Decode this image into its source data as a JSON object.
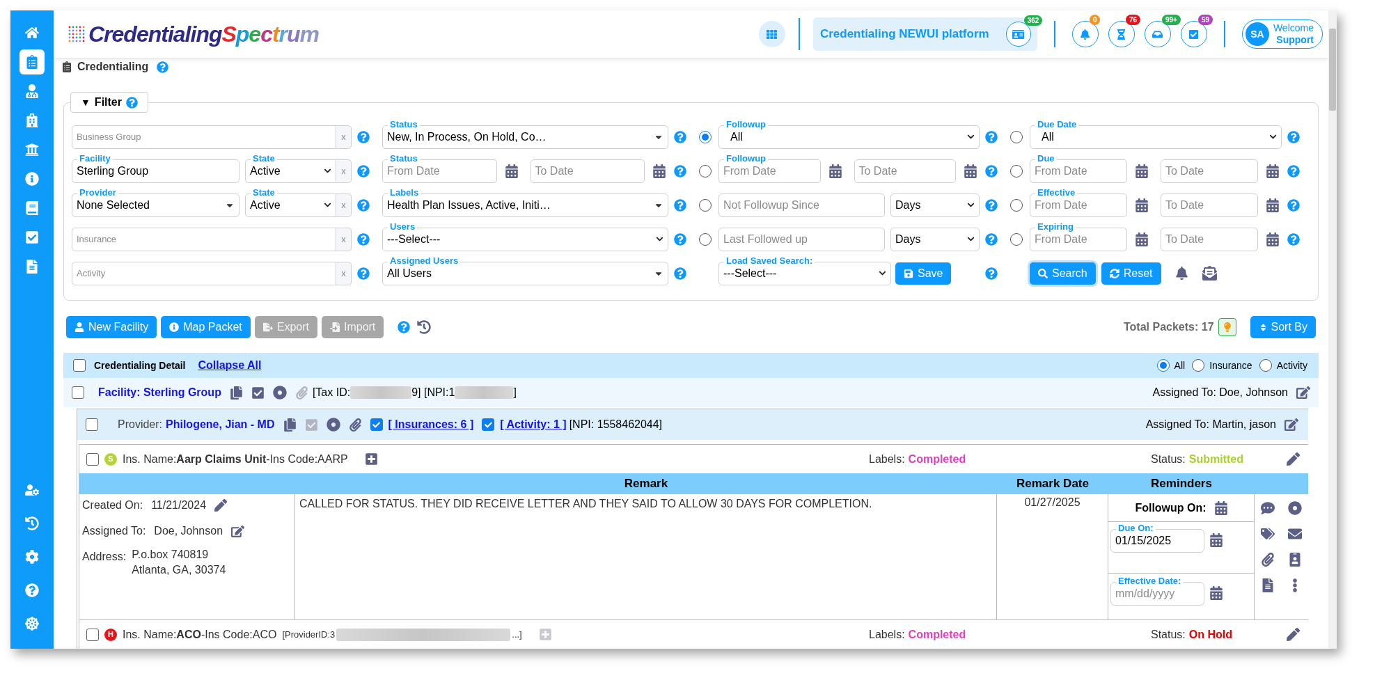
{
  "sidebar": {
    "items": [
      {
        "selected": false
      },
      {
        "selected": true
      },
      {
        "selected": false
      },
      {
        "selected": false
      },
      {
        "selected": false
      },
      {
        "selected": false
      },
      {
        "selected": false
      },
      {
        "selected": false
      },
      {
        "selected": false
      }
    ]
  },
  "header": {
    "logo": {
      "part_1": "Credentialing",
      "part_2": "Spectrum"
    },
    "platform": {
      "title": "Credentialing NEWUI platform",
      "badge": "362"
    },
    "notifications": [
      {
        "badge": "0",
        "color": "#f7931e"
      },
      {
        "badge": "76",
        "color": "#e8141b"
      },
      {
        "badge": "99+",
        "color": "#22b14c"
      },
      {
        "badge": "59",
        "color": "#b43fc0"
      }
    ],
    "user": {
      "initials": "SA",
      "greeting": "Welcome",
      "name": "Support"
    }
  },
  "breadcrumb": {
    "title": "Credentialing"
  },
  "filter": {
    "toggle": "▼",
    "title": "Filter",
    "columns": [
      {
        "rows": [
          {
            "kind": "text",
            "placeholder": "Business Group",
            "clear": "x"
          },
          {
            "kind": "text_state",
            "label": "Facility",
            "value": "Sterling Group",
            "state_label": "State",
            "state": "Active",
            "clear": "x"
          },
          {
            "kind": "select_state",
            "label": "Provider",
            "value": "None Selected",
            "state_label": "State",
            "state": "Active",
            "clear": "x"
          },
          {
            "kind": "text",
            "placeholder": "Insurance",
            "clear": "x"
          },
          {
            "kind": "text",
            "placeholder": "Activity",
            "clear": "x"
          }
        ]
      },
      {
        "rows": [
          {
            "kind": "multiselect",
            "label": "Status",
            "value": "New, In Process, On Hold, Co…"
          },
          {
            "kind": "date_range",
            "label": "Status",
            "from_placeholder": "From Date",
            "to_placeholder": "To Date"
          },
          {
            "kind": "multiselect",
            "label": "Labels",
            "value": "Health Plan Issues, Active, Initi…"
          },
          {
            "kind": "select",
            "label": "Users",
            "value": "---Select---"
          },
          {
            "kind": "multiselect",
            "label": "Assigned Users",
            "value": "All Users"
          }
        ]
      },
      {
        "rows": [
          {
            "kind": "select",
            "label": "Followup",
            "value": "All",
            "selected": true
          },
          {
            "kind": "date_range",
            "label": "Followup",
            "from_placeholder": "From Date",
            "to_placeholder": "To Date",
            "selected": false
          },
          {
            "kind": "text_unit",
            "placeholder": "Not Followup Since",
            "unit": "Days",
            "selected": false
          },
          {
            "kind": "text_unit",
            "placeholder": "Last Followed up",
            "unit": "Days",
            "selected": false
          }
        ]
      },
      {
        "rows": [
          {
            "kind": "select",
            "label": "Due Date",
            "value": "All",
            "selected": false
          },
          {
            "kind": "date_range",
            "label": "Due",
            "from_placeholder": "From Date",
            "to_placeholder": "To Date",
            "selected": false
          },
          {
            "kind": "date_range",
            "label": "Effective",
            "from_placeholder": "From Date",
            "to_placeholder": "To Date",
            "selected": false
          },
          {
            "kind": "date_range",
            "label": "Expiring",
            "from_placeholder": "From Date",
            "to_placeholder": "To Date",
            "selected": false
          }
        ]
      }
    ],
    "saved_search": {
      "label": "Load Saved Search:",
      "value": "---Select---",
      "button": "Save"
    },
    "actions": {
      "search": "Search",
      "reset": "Reset"
    }
  },
  "toolbar": {
    "buttons": [
      {
        "label": "New Facility",
        "disabled": false
      },
      {
        "label": "Map Packet",
        "disabled": false
      },
      {
        "label": "Export",
        "disabled": true
      },
      {
        "label": "Import",
        "disabled": true
      }
    ],
    "total_packets": "Total Packets: 17",
    "sort": "Sort By"
  },
  "detail": {
    "header": {
      "checked": false,
      "title": "Credentialing Detail",
      "collapse": "Collapse All",
      "views": [
        {
          "label": "All",
          "selected": true
        },
        {
          "label": "Insurance",
          "selected": false
        },
        {
          "label": "Activity",
          "selected": false
        }
      ]
    },
    "facility": {
      "checked": false,
      "title": "Facility: Sterling Group",
      "tax_prefix": "[Tax ID:",
      "npi_prefix": "9] [NPI:1",
      "npi_suffix": "]",
      "assigned": "Assigned To: Doe, Johnson"
    },
    "provider": {
      "checked": false,
      "label": "Provider:",
      "name": "Philogene, Jian - MD",
      "insurances": {
        "checked": true,
        "label": "[ Insurances: 6 ]"
      },
      "activity": {
        "checked": true,
        "label": "[ Activity: 1 ]"
      },
      "npi": "[NPI: 1558462044]",
      "assigned": "Assigned To: Martin, jason"
    },
    "insurances": [
      {
        "checked": false,
        "badge": "S",
        "color": "#b5d334",
        "name": "Ins. Name:**Aarp Claims Unit**-Ins Code:AARP",
        "labels_label": "Labels:",
        "labels": "Completed",
        "status_label": "Status:",
        "status": {
          "text": "Submitted",
          "color": "#a8d12a"
        },
        "table": {
          "columns": {
            "remark": "Remark",
            "remark_date": "Remark Date",
            "reminders": "Reminders"
          },
          "created_label": "Created On:",
          "created": "11/21/2024",
          "assigned_label": "Assigned To:",
          "assigned": "Doe, Johnson",
          "address_label": "Address:",
          "address": [
            "P.o.box 740819",
            "Atlanta, GA, 30374"
          ],
          "remark": "CALLED FOR STATUS. THEY DID RECEIVE LETTER AND THEY SAID TO ALLOW 30 DAYS FOR COMPLETION.",
          "remark_date": "01/27/2025",
          "followup": "Followup On:",
          "due_label": "Due On:",
          "due": "01/15/2025",
          "effective_label": "Effective Date:",
          "effective_placeholder": "mm/dd/yyyy"
        }
      },
      {
        "checked": false,
        "badge": "H",
        "color": "#e8141b",
        "name": "Ins. Name:**ACO**-Ins Code:ACO",
        "provider_prefix": "[ProviderID:3",
        "provider_suffix": "...]",
        "labels_label": "Labels:",
        "labels": "Completed",
        "status_label": "Status:",
        "status": {
          "text": "On Hold",
          "color": "#e60000"
        }
      }
    ]
  }
}
